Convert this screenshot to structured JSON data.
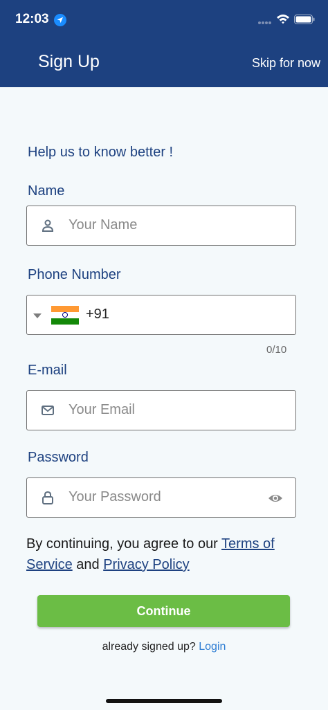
{
  "status_bar": {
    "time": "12:03",
    "icons": [
      "location-arrow-icon",
      "signal-icon",
      "wifi-icon",
      "battery-icon"
    ]
  },
  "header": {
    "title": "Sign Up",
    "skip_label": "Skip for now"
  },
  "form": {
    "intro": "Help us to know better !",
    "name": {
      "label": "Name",
      "placeholder": "Your Name",
      "icon": "person-icon"
    },
    "phone": {
      "label": "Phone Number",
      "country_flag": "india-flag-icon",
      "dial_code": "+91",
      "counter": "0/10"
    },
    "email": {
      "label": "E-mail",
      "placeholder": "Your Email",
      "icon": "mail-icon"
    },
    "password": {
      "label": "Password",
      "placeholder": "Your Password",
      "icon": "lock-icon",
      "toggle_icon": "eye-icon"
    }
  },
  "terms": {
    "prefix": "By continuing, you agree to our ",
    "tos": "Terms of Service",
    "conjunction": " and ",
    "privacy": "Privacy Policy"
  },
  "continue_label": "Continue",
  "footer": {
    "prompt": "already signed up?",
    "login": "Login"
  },
  "colors": {
    "header_bg": "#1d4180",
    "primary_text": "#1d4180",
    "button_bg": "#6bbd45",
    "link": "#2b7cd3",
    "page_bg": "#f4f9fb"
  }
}
